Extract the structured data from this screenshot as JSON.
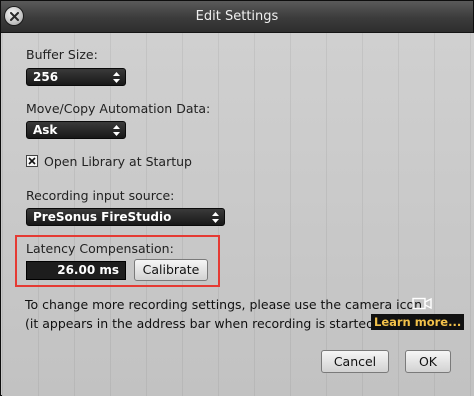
{
  "window": {
    "title": "Edit Settings"
  },
  "buffer": {
    "label": "Buffer Size:",
    "value": "256"
  },
  "automation": {
    "label": "Move/Copy Automation Data:",
    "value": "Ask"
  },
  "library": {
    "label": "Open Library at Startup",
    "checked": true
  },
  "recording": {
    "label": "Recording input source:",
    "value": "PreSonus FireStudio"
  },
  "latency": {
    "label": "Latency Compensation:",
    "value": "26.00 ms",
    "calibrate_label": "Calibrate"
  },
  "info": {
    "line1": "To change more recording settings, please use the camera icon",
    "line2": "(it appears in the address bar when recording is started).",
    "learn_more": "Learn more..."
  },
  "buttons": {
    "cancel": "Cancel",
    "ok": "OK"
  },
  "colors": {
    "highlight_border": "#e53a33",
    "learn_more_text": "#f2c14a"
  }
}
